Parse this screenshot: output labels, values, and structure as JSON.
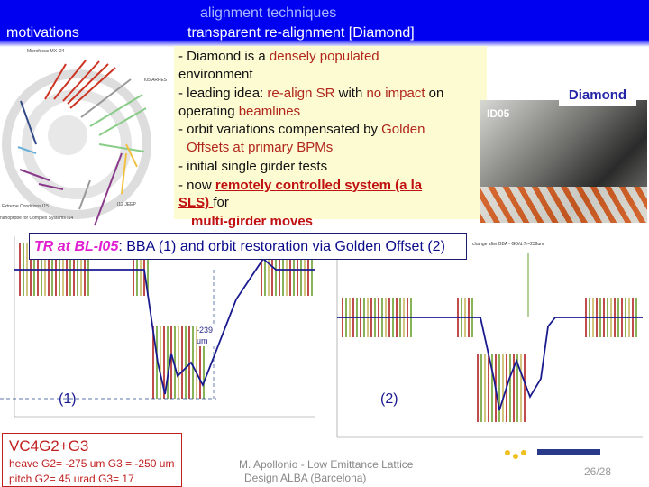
{
  "header": {
    "section": "motivations",
    "title1": "alignment techniques",
    "title2": "transparent re-alignment [Diamond]"
  },
  "bullets": {
    "b1a": "-   Diamond   is   a   ",
    "b1b": "densely   populated",
    "b1c": "environment",
    "b2a": "- leading idea: ",
    "b2b": "re-align SR",
    "b2c": " with ",
    "b2d": "no impact",
    "b2e": " on",
    "b2f": "operating ",
    "b2g": "beamlines",
    "b3a": "- orbit variations compensated by ",
    "b3b": "Golden",
    "b3c": "Offsets at primary BPMs",
    "b4": "- initial single girder tests",
    "b5a": "-  now  ",
    "b5b": "remotely  controlled  system  (a  la",
    "b5c": "SLS) ",
    "b5d": "for",
    "b6": "multi-girder moves"
  },
  "photo": {
    "label": "ID05",
    "caption": "Diamond"
  },
  "tr_box": {
    "a": "TR at BL-I05",
    "b": ": BBA (1) and orbit restoration via Golden Offset (2)"
  },
  "plots": {
    "label1": "(1)",
    "label2": "(2)",
    "annotation": "-239 um",
    "plot2_title": "change after BBA - GO/d.7r=239um"
  },
  "vc_box": {
    "title": "VC4G2+G3",
    "line1": "heave G2= -275 um  G3 = -250 um",
    "line2": "pitch  G2= 45 urad  G3= 17"
  },
  "footer": {
    "line1": "M. Apollonio - Low Emittance Lattice",
    "line2": "Design            ALBA (Barcelona)",
    "page": "26/28"
  },
  "colors": {
    "header": "#0000f0",
    "accent_red": "#b0261c",
    "magenta": "#e020d0",
    "navy": "#0a0a8a"
  }
}
